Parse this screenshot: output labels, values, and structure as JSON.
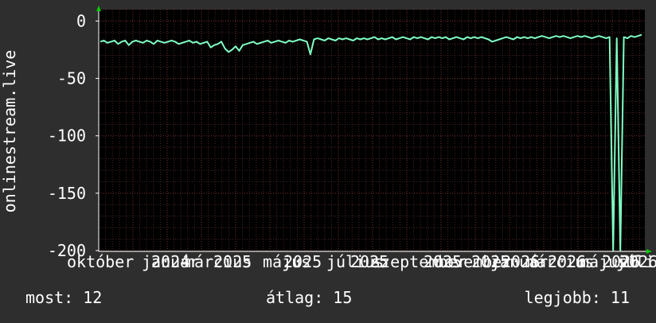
{
  "chart_data": {
    "type": "line",
    "ylabel": "onlinestream.live",
    "ylim": [
      -200,
      10
    ],
    "yticks": [
      0,
      -50,
      -100,
      -150,
      -200
    ],
    "ytick_labels": [
      "0",
      "-50",
      "-100",
      "-150",
      "-200"
    ],
    "xtick_labels": [
      "október",
      "január",
      "2024",
      "március",
      "2025",
      "május",
      "2025",
      "július",
      "2025",
      "szeptember",
      "2025",
      "november",
      "2025",
      "január",
      "2026",
      "március",
      "2026",
      "május",
      "2026",
      "július",
      "2026"
    ],
    "grid": true,
    "colors": {
      "background": "#000000",
      "line": "#7fffc4",
      "grid": "#5a2a2a",
      "axis": "#ffffff",
      "arrow": "#00cc00"
    },
    "series": [
      {
        "values": [
          -18,
          -17,
          -19,
          -18,
          -17,
          -20,
          -18,
          -17,
          -21,
          -18,
          -17,
          -18,
          -19,
          -17,
          -18,
          -20,
          -17,
          -18,
          -19,
          -18,
          -17,
          -18,
          -20,
          -19,
          -18,
          -17,
          -19,
          -18,
          -20,
          -19,
          -18,
          -23,
          -21,
          -20,
          -18,
          -24,
          -27,
          -25,
          -22,
          -26,
          -21,
          -20,
          -19,
          -18,
          -20,
          -19,
          -18,
          -17,
          -19,
          -18,
          -17,
          -18,
          -19,
          -17,
          -18,
          -17,
          -16,
          -17,
          -18,
          -29,
          -16,
          -15,
          -16,
          -17,
          -15,
          -16,
          -17,
          -15,
          -16,
          -15,
          -16,
          -17,
          -15,
          -16,
          -15,
          -16,
          -15,
          -14,
          -16,
          -15,
          -16,
          -15,
          -14,
          -16,
          -15,
          -14,
          -15,
          -16,
          -14,
          -15,
          -14,
          -15,
          -16,
          -14,
          -15,
          -14,
          -15,
          -14,
          -16,
          -15,
          -14,
          -15,
          -16,
          -14,
          -15,
          -14,
          -15,
          -14,
          -15,
          -16,
          -18,
          -17,
          -16,
          -15,
          -14,
          -15,
          -16,
          -14,
          -15,
          -14,
          -15,
          -14,
          -15,
          -14,
          -13,
          -14,
          -15,
          -14,
          -13,
          -14,
          -13,
          -14,
          -15,
          -14,
          -13,
          -14,
          -13,
          -14,
          -15,
          -14,
          -13,
          -14,
          -15,
          -14,
          -200,
          -15,
          -200,
          -14,
          -15,
          -13,
          -14,
          -13,
          -12
        ]
      }
    ]
  },
  "stats": {
    "current": "most: 12",
    "average": "átlag: 15",
    "best": "legjobb: 11"
  }
}
